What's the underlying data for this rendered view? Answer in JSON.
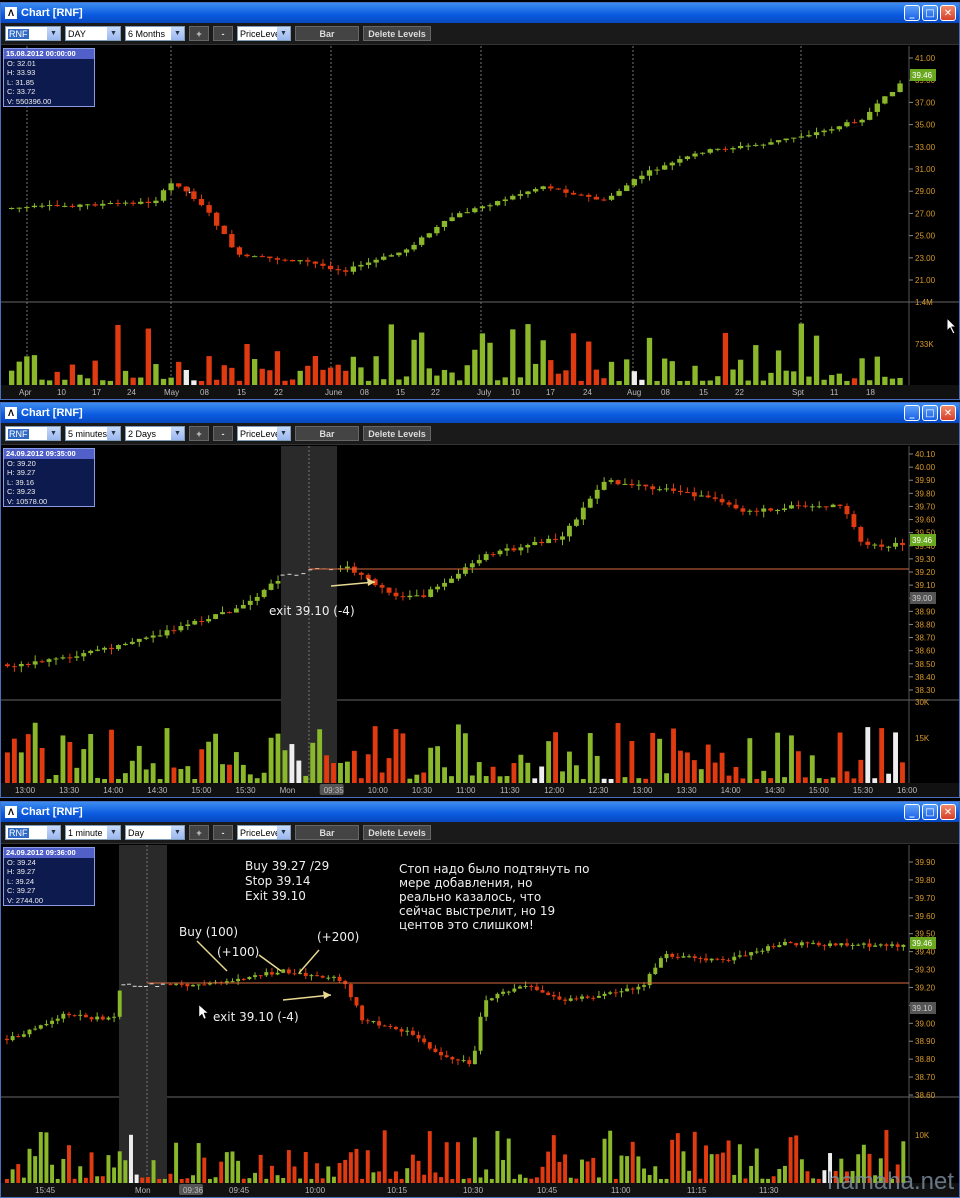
{
  "windows": [
    {
      "title": "Chart [RNF]",
      "symbol": "RNF",
      "interval": "DAY",
      "range": "6 Months",
      "study": "PriceLeve",
      "bar_label": "Bar",
      "delete_label": "Delete Levels",
      "plus": "+",
      "minus": "-",
      "ohlc": {
        "date": "15.08.2012 00:00:00",
        "o": "O: 32.01",
        "h": "H: 33.93",
        "l": "L: 31.85",
        "c": "C: 33.72",
        "v": "V: 550396.00"
      },
      "price_ticks": [
        "41.00",
        "39.00",
        "37.00",
        "35.00",
        "33.00",
        "31.00",
        "29.00",
        "27.00",
        "25.00",
        "23.00",
        "21.00"
      ],
      "last_price": "39.46",
      "vol_ticks": [
        "1.4M",
        "733K"
      ],
      "x_labels": [
        "Apr",
        "10",
        "17",
        "24",
        "May",
        "08",
        "15",
        "22",
        "June",
        "08",
        "15",
        "22",
        "July",
        "10",
        "17",
        "24",
        "Aug",
        "08",
        "15",
        "22",
        "Spt",
        "11",
        "18"
      ]
    },
    {
      "title": "Chart [RNF]",
      "symbol": "RNF",
      "interval": "5 minutes",
      "range": "2 Days",
      "study": "PriceLeve",
      "bar_label": "Bar",
      "delete_label": "Delete Levels",
      "plus": "+",
      "minus": "-",
      "ohlc": {
        "date": "24.09.2012 09:35:00",
        "o": "O: 39.20",
        "h": "H: 39.27",
        "l": "L: 39.16",
        "c": "C: 39.23",
        "v": "V: 10578.00"
      },
      "price_ticks": [
        "40.10",
        "40.00",
        "39.90",
        "39.80",
        "39.70",
        "39.60",
        "39.50",
        "39.40",
        "39.30",
        "39.20",
        "39.10",
        "39.00",
        "38.90",
        "38.80",
        "38.70",
        "38.60",
        "38.50",
        "38.40",
        "38.30"
      ],
      "last_price": "39.46",
      "level_price": "39.00",
      "vol_ticks": [
        "30K",
        "15K"
      ],
      "x_labels": [
        "13:00",
        "13:30",
        "14:00",
        "14:30",
        "15:00",
        "15:30",
        "Mon",
        "09:35",
        "10:00",
        "10:30",
        "11:00",
        "11:30",
        "12:00",
        "12:30",
        "13:00",
        "13:30",
        "14:00",
        "14:30",
        "15:00",
        "15:30",
        "16:00"
      ],
      "annotation": "exit 39.10 (-4)"
    },
    {
      "title": "Chart [RNF]",
      "symbol": "RNF",
      "interval": "1 minute",
      "range": "Day",
      "study": "PriceLeve",
      "bar_label": "Bar",
      "delete_label": "Delete Levels",
      "plus": "+",
      "minus": "-",
      "ohlc": {
        "date": "24.09.2012 09:36:00",
        "o": "O: 39.24",
        "h": "H: 39.27",
        "l": "L: 39.24",
        "c": "C: 39.27",
        "v": "V: 2744.00"
      },
      "price_ticks": [
        "39.90",
        "39.80",
        "39.70",
        "39.60",
        "39.50",
        "39.40",
        "39.30",
        "39.20",
        "39.10",
        "39.00",
        "38.90",
        "38.80",
        "38.70",
        "38.60"
      ],
      "last_price": "39.46",
      "level_price": "39.10",
      "vol_ticks": [
        "10K"
      ],
      "x_labels": [
        "15:45",
        "Mon",
        "09:36",
        "09:45",
        "10:00",
        "10:15",
        "10:30",
        "10:45",
        "11:00",
        "11:15",
        "11:30"
      ],
      "annotations": {
        "trade": [
          "Buy 39.27 /29",
          "Stop 39.14",
          "Exit 39.10"
        ],
        "russian": [
          "Стоп надо было подтянуть по",
          "мере добавления, но",
          "реально казалось, что",
          "сейчас выстрелит, но 19",
          "центов это слишком!"
        ],
        "buy": "Buy (100)",
        "add1": "(+100)",
        "add2": "(+200)",
        "exit": "exit 39.10 (-4)"
      }
    }
  ],
  "watermark": "hamaha.net",
  "colors": {
    "up": "#8ab82a",
    "down": "#e03a10",
    "level": "#d86a3a",
    "price_axis": "#d89a2a"
  }
}
